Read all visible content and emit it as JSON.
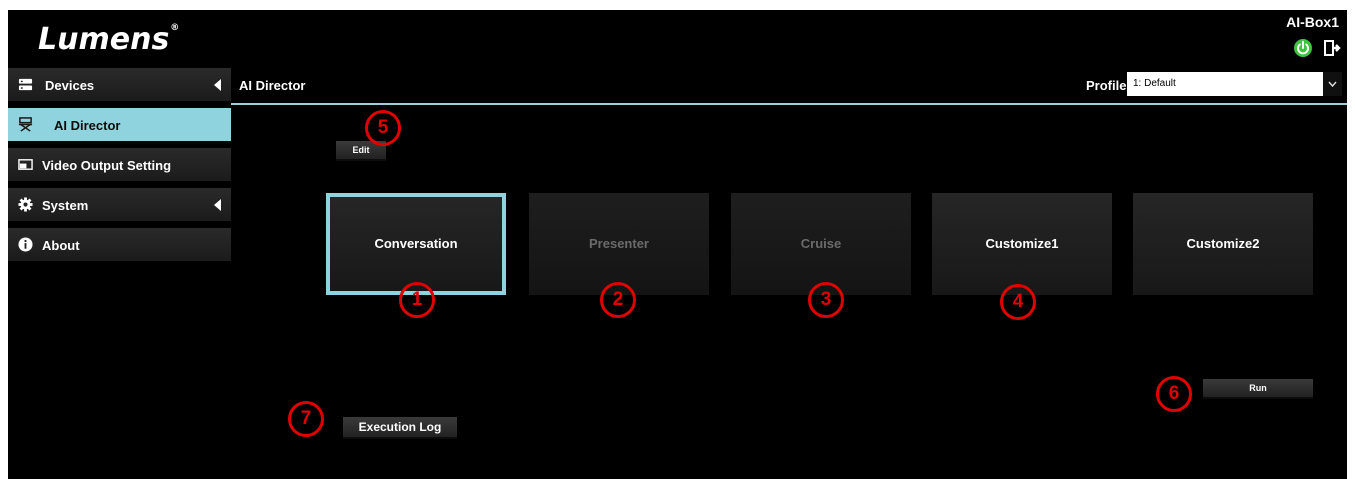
{
  "header": {
    "logo_text": "Lumens",
    "logo_mark": "®",
    "device_name": "AI-Box1",
    "power_icon": "power-icon",
    "logout_icon": "logout-icon",
    "power_color": "#3cc43c"
  },
  "sidebar": {
    "items": [
      {
        "label": "Devices",
        "icon": "server-icon",
        "expandable": true
      },
      {
        "label": "AI Director",
        "icon": "director-chair-icon",
        "active": true
      },
      {
        "label": "Video Output Setting",
        "icon": "monitor-icon"
      },
      {
        "label": "System",
        "icon": "gear-icon",
        "expandable": true
      },
      {
        "label": "About",
        "icon": "info-icon"
      }
    ],
    "active_color": "#8fd3df"
  },
  "main": {
    "title": "AI Director",
    "profile_label": "Profile",
    "profile_value": "1: Default",
    "edit_label": "Edit",
    "run_label": "Run",
    "log_label": "Execution Log",
    "modes": [
      {
        "label": "Conversation",
        "state": "selected"
      },
      {
        "label": "Presenter",
        "state": "disabled"
      },
      {
        "label": "Cruise",
        "state": "disabled"
      },
      {
        "label": "Customize1",
        "state": "enabled"
      },
      {
        "label": "Customize2",
        "state": "enabled"
      }
    ]
  },
  "callouts": [
    "1",
    "2",
    "3",
    "4",
    "5",
    "6",
    "7"
  ],
  "callout_color": "#e00000"
}
